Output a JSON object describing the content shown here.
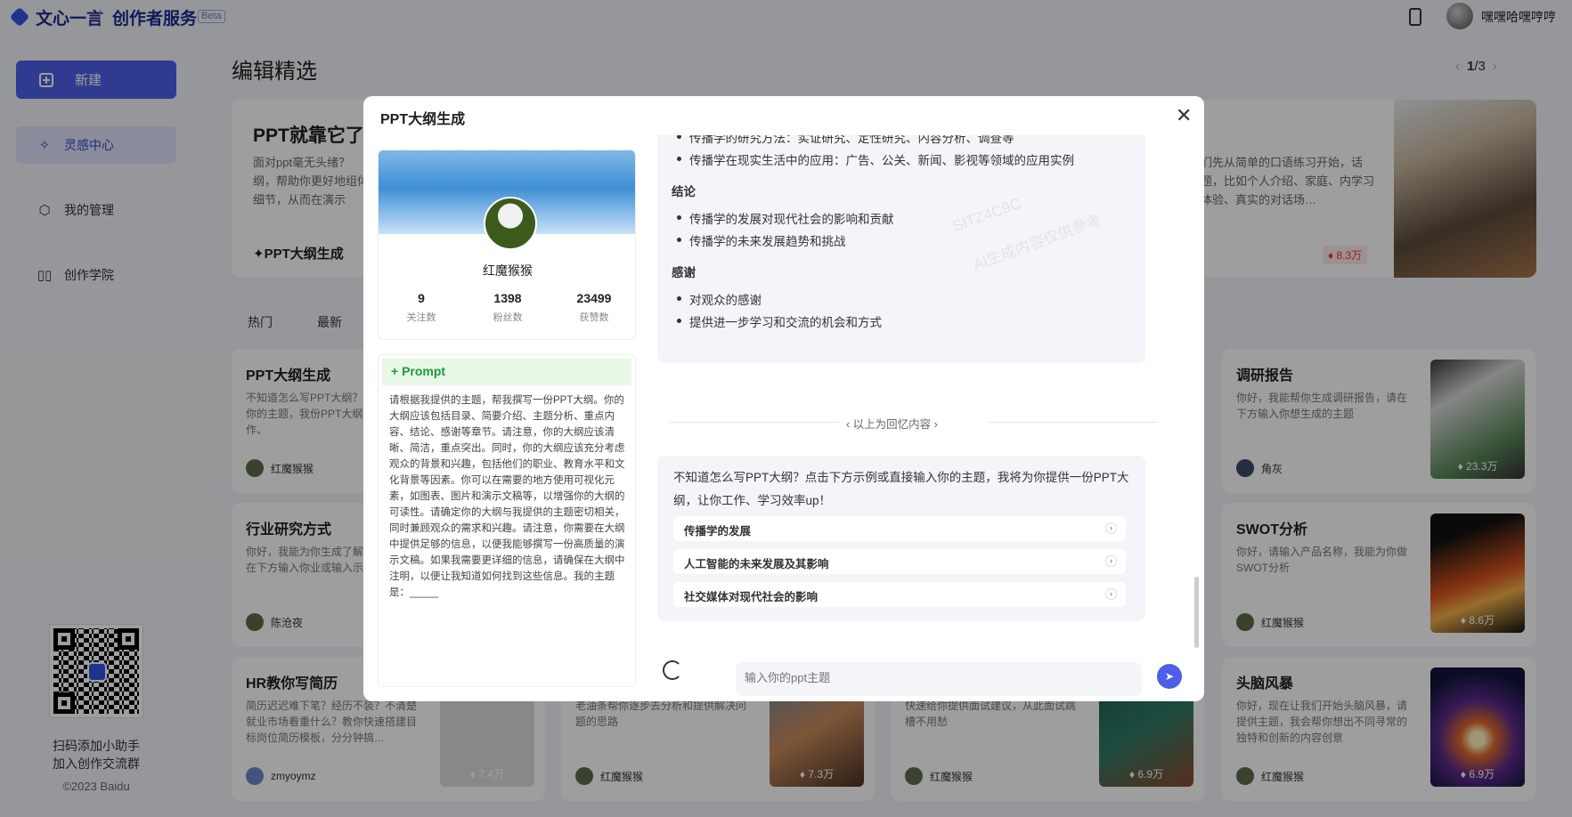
{
  "header": {
    "brand": "文心一言",
    "product": "创作者服务",
    "beta": "Beta",
    "username": "嘿嘿哈嘿哼哼"
  },
  "sidebar": {
    "new_label": "新建",
    "items": [
      {
        "label": "灵感中心",
        "icon": "sparkle-icon",
        "active": true
      },
      {
        "label": "我的管理",
        "icon": "cube-icon",
        "active": false
      },
      {
        "label": "创作学院",
        "icon": "book-icon",
        "active": false
      }
    ],
    "qr_caption_1": "扫码添加小助手",
    "qr_caption_2": "加入创作交流群",
    "copyright": "©2023 Baidu"
  },
  "main": {
    "section_title": "编辑精选",
    "pager": {
      "current": "1",
      "total": "3"
    },
    "hero": {
      "title": "PPT就靠它了",
      "desc": "面对ppt毫无头绪？纲，帮助你更好地组体细节，从而在演示",
      "tag": "PPT大纲生成",
      "desc_right": "们先从简单的口语练习开始，话题，比如个人介绍、家庭、内学习体验、真实的对话场…",
      "badge": "8.3万"
    },
    "tabs": [
      "热门",
      "最新"
    ],
    "cards": [
      {
        "title": "PPT大纲生成",
        "desc": "不知道怎么写PPT大纲？或直接输入你的主题，我份PPT大纲，让你工作、",
        "user": "红魔猴猴"
      },
      {
        "title": "行业研究方式",
        "desc": "你好，我能为你生成了解究方式，请在下方输入你业或输入示例",
        "user": "陈沧夜"
      },
      {
        "title": "HR教你写简历",
        "desc": "简历迟迟难下笔？经历不装？不清楚就业市场看重什么？教你快速搭建目标岗位简历模板，分分钟搞…",
        "user": "zmyoymz",
        "count": "7.4万"
      },
      {
        "title": "",
        "desc": "老油条帮你逐步去分析和提供解决问题的思路",
        "user": "红魔猴猴",
        "count": "7.3万"
      },
      {
        "title": "",
        "desc": "快速给你提供面试建议，从此面试跳槽不用愁",
        "user": "红魔猴猴",
        "count": "6.9万"
      },
      {
        "title": "调研报告",
        "desc": "你好，我能帮你生成调研报告，请在下方输入你想生成的主题",
        "user": "角灰",
        "count": "23.3万"
      },
      {
        "title": "SWOT分析",
        "desc": "你好，请输入产品名称，我能为你做SWOT分析",
        "user": "红魔猴猴",
        "count": "8.6万"
      },
      {
        "title": "头脑风暴",
        "desc": "你好，现在让我们开始头脑风暴，请提供主题，我会帮你想出不同寻常的独特和创新的内容创意",
        "user": "红魔猴猴",
        "count": "6.9万"
      }
    ]
  },
  "modal": {
    "title": "PPT大纲生成",
    "profile": {
      "name": "红魔猴猴",
      "stats": [
        {
          "value": "9",
          "label": "关注数"
        },
        {
          "value": "1398",
          "label": "粉丝数"
        },
        {
          "value": "23499",
          "label": "获赞数"
        }
      ]
    },
    "prompt_label": "+ Prompt",
    "prompt_text": "请根据我提供的主题，帮我撰写一份PPT大纲。你的大纲应该包括目录、简要介绍、主题分析、重点内容、结论、感谢等章节。请注意，你的大纲应该清晰、简洁，重点突出。同时，你的大纲应该充分考虑观众的背景和兴趣，包括他们的职业、教育水平和文化背景等因素。你可以在需要的地方使用可视化元素，如图表、图片和演示文稿等，以增强你的大纲的可读性。请确定你的大纲与我提供的主题密切相关，同时兼顾观众的需求和兴趣。请注意，你需要在大纲中提供足够的信息，以便我能够撰写一份高质量的演示文稿。如果我需要更详细的信息，请确保在大纲中注明，以便让我知道如何找到这些信息。我的主题是：_____",
    "answer": {
      "partial_line": "传播学的研究方法：实证研究、定性研究、内容分析、调查等",
      "line_app": "传播学在现实生活中的应用：广告、公关、新闻、影视等领域的应用实例",
      "h_conclusion": "结论",
      "conclusion": [
        "传播学的发展对现代社会的影响和贡献",
        "传播学的未来发展趋势和挑战"
      ],
      "h_thanks": "感谢",
      "thanks": [
        "对观众的感谢",
        "提供进一步学习和交流的机会和方式"
      ]
    },
    "memory_label": "以上为回忆内容",
    "greeting": "不知道怎么写PPT大纲？点击下方示例或直接输入你的主题，我将为你提供一份PPT大纲，让你工作、学习效率up！",
    "suggestions": [
      "传播学的发展",
      "人工智能的未来发展及其影响",
      "社交媒体对现代社会的影响"
    ],
    "input_placeholder": "输入你的ppt主题",
    "watermark": "SITZ4C9C",
    "watermark2": "AI生成内容仅供参考"
  }
}
